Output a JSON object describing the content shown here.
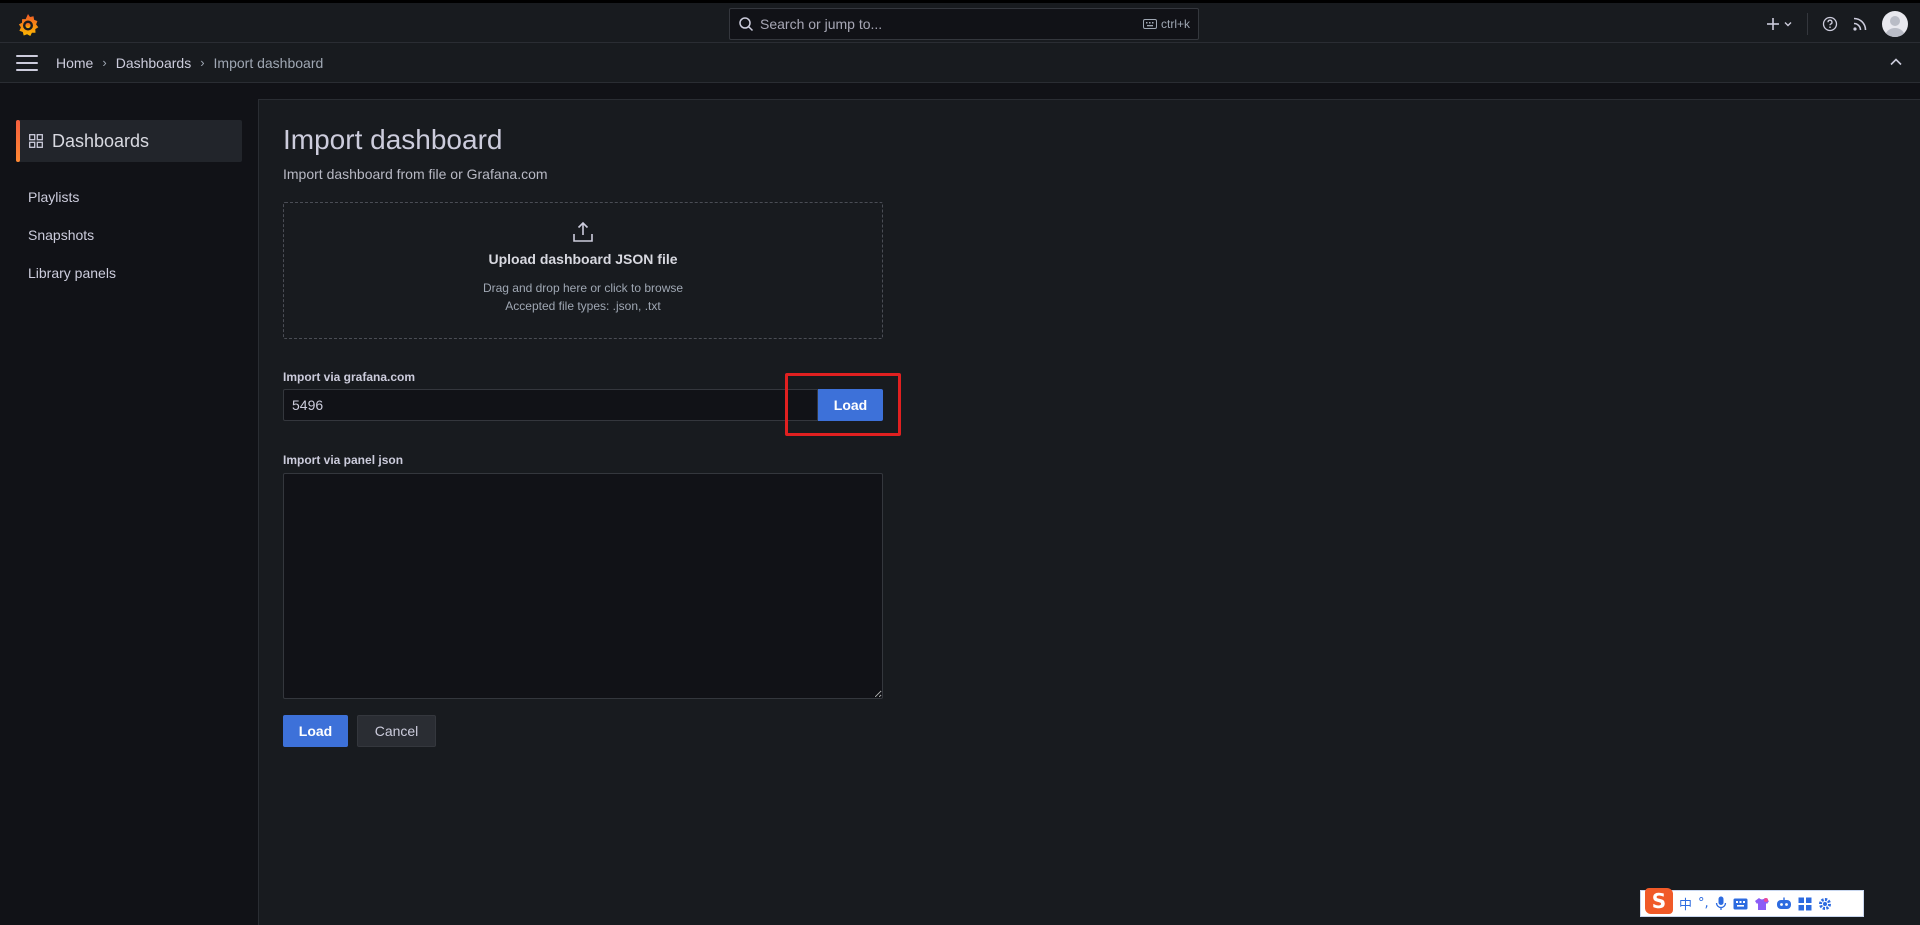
{
  "topbar": {
    "logo": "grafana-logo",
    "search": {
      "placeholder": "Search or jump to...",
      "shortcut": "ctrl+k"
    },
    "icons": [
      "plus-icon",
      "chevron-down-icon",
      "help-icon",
      "rss-icon",
      "avatar"
    ]
  },
  "breadcrumb": {
    "items": [
      "Home",
      "Dashboards",
      "Import dashboard"
    ]
  },
  "sidebar": {
    "active": "Dashboards",
    "items": [
      "Playlists",
      "Snapshots",
      "Library panels"
    ]
  },
  "page": {
    "title": "Import dashboard",
    "subtitle": "Import dashboard from file or Grafana.com"
  },
  "upload": {
    "title": "Upload dashboard JSON file",
    "hint": "Drag and drop here or click to browse",
    "accepted": "Accepted file types: .json, .txt"
  },
  "grafana_import": {
    "label": "Import via grafana.com",
    "value": "5496",
    "load_label": "Load"
  },
  "panel_json": {
    "label": "Import via panel json",
    "value": ""
  },
  "actions": {
    "load_label": "Load",
    "cancel_label": "Cancel"
  },
  "ime_toolbar": {
    "logo": "S",
    "items": [
      "中",
      "°,",
      "mic-icon",
      "keyboard-icon",
      "shirt-icon",
      "robot-icon",
      "grid-icon",
      "settings-icon"
    ]
  },
  "colors": {
    "accent": "#3d71d9",
    "highlight": "#e02020",
    "brand": "#f55f3e",
    "background": "#111217",
    "panel": "#181b1f"
  }
}
